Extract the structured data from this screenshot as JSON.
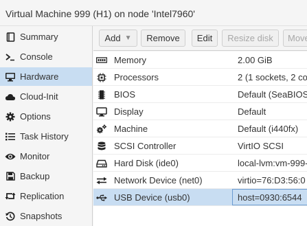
{
  "window": {
    "title": "Virtual Machine 999 (H1) on node 'Intel7960'"
  },
  "sidebar": {
    "items": [
      {
        "label": "Summary",
        "icon": "book-icon"
      },
      {
        "label": "Console",
        "icon": "terminal-icon"
      },
      {
        "label": "Hardware",
        "icon": "desktop-icon",
        "selected": true
      },
      {
        "label": "Cloud-Init",
        "icon": "cloud-icon"
      },
      {
        "label": "Options",
        "icon": "gear-icon"
      },
      {
        "label": "Task History",
        "icon": "list-icon"
      },
      {
        "label": "Monitor",
        "icon": "eye-icon"
      },
      {
        "label": "Backup",
        "icon": "floppy-icon"
      },
      {
        "label": "Replication",
        "icon": "retweet-icon"
      },
      {
        "label": "Snapshots",
        "icon": "history-icon"
      }
    ]
  },
  "toolbar": {
    "add_label": "Add",
    "remove_label": "Remove",
    "edit_label": "Edit",
    "resize_label": "Resize disk",
    "move_label": "Move"
  },
  "hardware": {
    "rows": [
      {
        "name": "Memory",
        "value": "2.00 GiB",
        "icon": "memory-icon"
      },
      {
        "name": "Processors",
        "value": "2 (1 sockets, 2 co",
        "icon": "cpu-icon"
      },
      {
        "name": "BIOS",
        "value": "Default (SeaBIOS",
        "icon": "microchip-icon"
      },
      {
        "name": "Display",
        "value": "Default",
        "icon": "monitor-icon"
      },
      {
        "name": "Machine",
        "value": "Default (i440fx)",
        "icon": "cogs-icon"
      },
      {
        "name": "SCSI Controller",
        "value": "VirtIO SCSI",
        "icon": "database-icon"
      },
      {
        "name": "Hard Disk (ide0)",
        "value": "local-lvm:vm-999-",
        "icon": "hdd-icon"
      },
      {
        "name": "Network Device (net0)",
        "value": "virtio=76:D3:56:0",
        "icon": "exchange-icon"
      },
      {
        "name": "USB Device (usb0)",
        "value": "host=0930:6544",
        "icon": "usb-icon",
        "selected": true
      }
    ]
  }
}
